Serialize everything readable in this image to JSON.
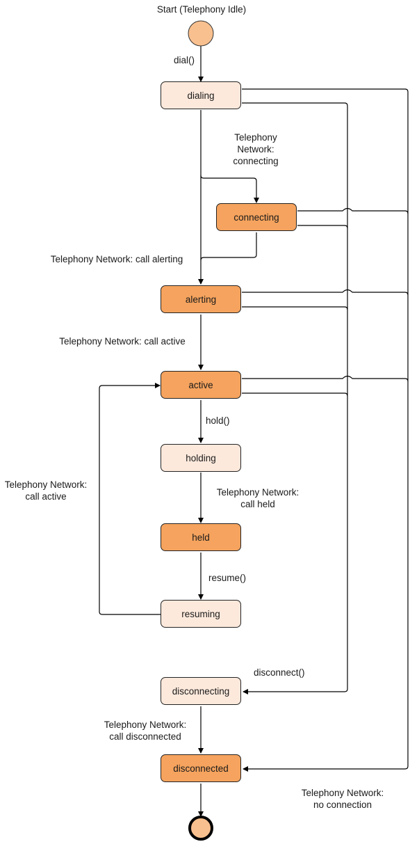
{
  "title": "Start (Telephony Idle)",
  "colors": {
    "state_light": "#fde9dc",
    "state_dark": "#f5a35e",
    "terminal_fill": "#f9c08f",
    "line": "#000000"
  },
  "states": {
    "dialing": "dialing",
    "connecting": "connecting",
    "alerting": "alerting",
    "active": "active",
    "holding": "holding",
    "held": "held",
    "resuming": "resuming",
    "disconnecting": "disconnecting",
    "disconnected": "disconnected"
  },
  "transitions": {
    "dial": "dial()",
    "network_connecting": "Telephony\nNetwork:\nconnecting",
    "network_call_alerting": "Telephony Network: call alerting",
    "network_call_active": "Telephony Network: call active",
    "hold": "hold()",
    "network_call_held": "Telephony Network:\ncall held",
    "resume": "resume()",
    "network_call_active_resume": "Telephony Network:\ncall active",
    "disconnect": "disconnect()",
    "network_call_disconnected": "Telephony Network:\ncall disconnected",
    "network_no_connection": "Telephony Network:\nno connection"
  }
}
